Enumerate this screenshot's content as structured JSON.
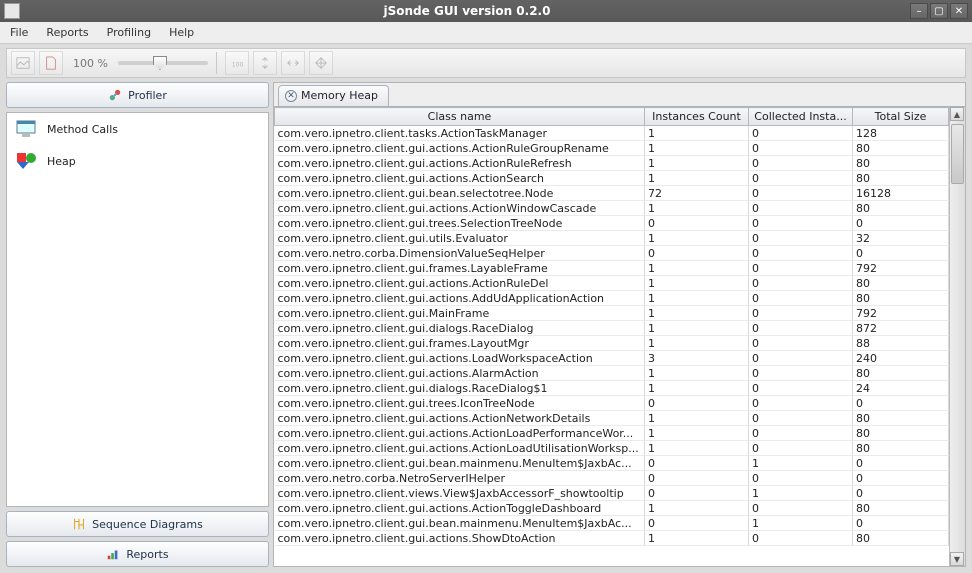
{
  "window": {
    "title": "jSonde GUI version 0.2.0"
  },
  "menu": {
    "items": [
      "File",
      "Reports",
      "Profiling",
      "Help"
    ]
  },
  "toolbar": {
    "zoom": "100 %"
  },
  "sidebar": {
    "profiler_btn": "Profiler",
    "sequence_btn": "Sequence Diagrams",
    "reports_btn": "Reports",
    "items": [
      {
        "label": "Method Calls"
      },
      {
        "label": "Heap"
      }
    ]
  },
  "tab": {
    "label": "Memory Heap"
  },
  "table": {
    "columns": [
      "Class name",
      "Instances Count",
      "Collected Insta...",
      "Total Size"
    ],
    "rows": [
      [
        "com.vero.ipnetro.client.tasks.ActionTaskManager",
        "1",
        "0",
        "128"
      ],
      [
        "com.vero.ipnetro.client.gui.actions.ActionRuleGroupRename",
        "1",
        "0",
        "80"
      ],
      [
        "com.vero.ipnetro.client.gui.actions.ActionRuleRefresh",
        "1",
        "0",
        "80"
      ],
      [
        "com.vero.ipnetro.client.gui.actions.ActionSearch",
        "1",
        "0",
        "80"
      ],
      [
        "com.vero.ipnetro.client.gui.bean.selectotree.Node",
        "72",
        "0",
        "16128"
      ],
      [
        "com.vero.ipnetro.client.gui.actions.ActionWindowCascade",
        "1",
        "0",
        "80"
      ],
      [
        "com.vero.ipnetro.client.gui.trees.SelectionTreeNode",
        "0",
        "0",
        "0"
      ],
      [
        "com.vero.ipnetro.client.gui.utils.Evaluator",
        "1",
        "0",
        "32"
      ],
      [
        "com.vero.netro.corba.DimensionValueSeqHelper",
        "0",
        "0",
        "0"
      ],
      [
        "com.vero.ipnetro.client.gui.frames.LayableFrame",
        "1",
        "0",
        "792"
      ],
      [
        "com.vero.ipnetro.client.gui.actions.ActionRuleDel",
        "1",
        "0",
        "80"
      ],
      [
        "com.vero.ipnetro.client.gui.actions.AddUdApplicationAction",
        "1",
        "0",
        "80"
      ],
      [
        "com.vero.ipnetro.client.gui.MainFrame",
        "1",
        "0",
        "792"
      ],
      [
        "com.vero.ipnetro.client.gui.dialogs.RaceDialog",
        "1",
        "0",
        "872"
      ],
      [
        "com.vero.ipnetro.client.gui.frames.LayoutMgr",
        "1",
        "0",
        "88"
      ],
      [
        "com.vero.ipnetro.client.gui.actions.LoadWorkspaceAction",
        "3",
        "0",
        "240"
      ],
      [
        "com.vero.ipnetro.client.gui.actions.AlarmAction",
        "1",
        "0",
        "80"
      ],
      [
        "com.vero.ipnetro.client.gui.dialogs.RaceDialog$1",
        "1",
        "0",
        "24"
      ],
      [
        "com.vero.ipnetro.client.gui.trees.IconTreeNode",
        "0",
        "0",
        "0"
      ],
      [
        "com.vero.ipnetro.client.gui.actions.ActionNetworkDetails",
        "1",
        "0",
        "80"
      ],
      [
        "com.vero.ipnetro.client.gui.actions.ActionLoadPerformanceWor...",
        "1",
        "0",
        "80"
      ],
      [
        "com.vero.ipnetro.client.gui.actions.ActionLoadUtilisationWorksp...",
        "1",
        "0",
        "80"
      ],
      [
        "com.vero.ipnetro.client.gui.bean.mainmenu.MenuItem$JaxbAc...",
        "0",
        "1",
        "0"
      ],
      [
        "com.vero.netro.corba.NetroServerIHelper",
        "0",
        "0",
        "0"
      ],
      [
        "com.vero.ipnetro.client.views.View$JaxbAccessorF_showtooltip",
        "0",
        "1",
        "0"
      ],
      [
        "com.vero.ipnetro.client.gui.actions.ActionToggleDashboard",
        "1",
        "0",
        "80"
      ],
      [
        "com.vero.ipnetro.client.gui.bean.mainmenu.MenuItem$JaxbAc...",
        "0",
        "1",
        "0"
      ],
      [
        "com.vero.ipnetro.client.gui.actions.ShowDtoAction",
        "1",
        "0",
        "80"
      ]
    ]
  }
}
